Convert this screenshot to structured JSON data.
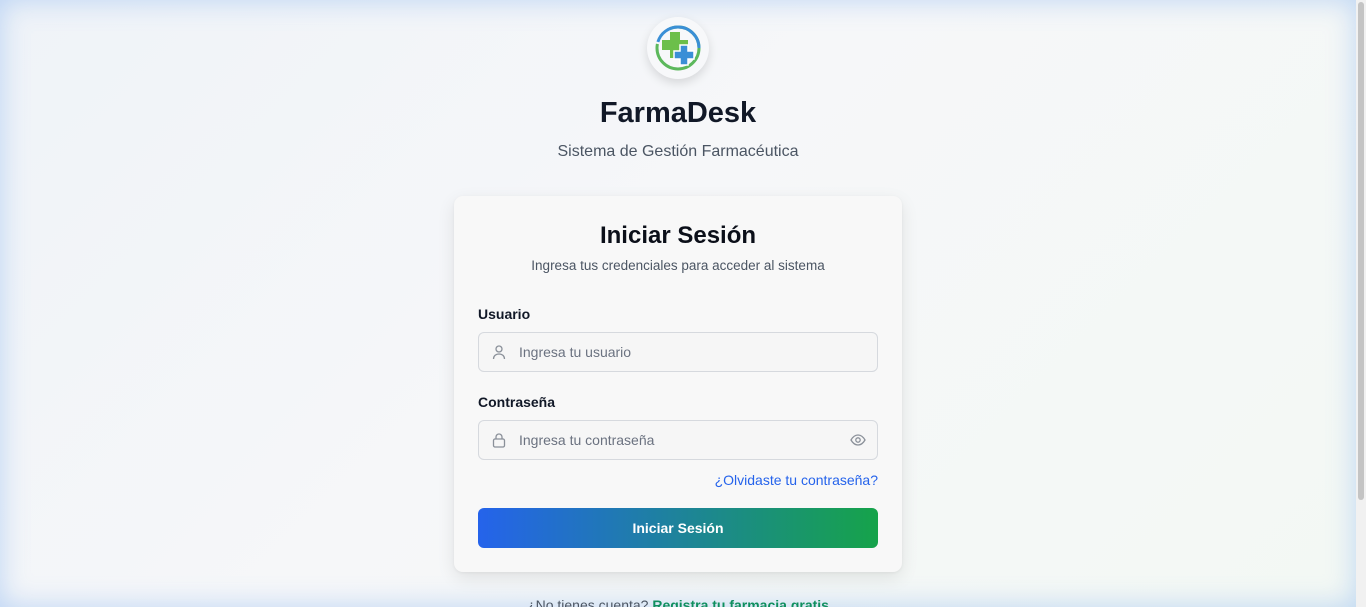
{
  "brand": {
    "logo_icon": "medical-cross-logo-icon",
    "title": "FarmaDesk",
    "subtitle": "Sistema de Gestión Farmacéutica"
  },
  "login": {
    "title": "Iniciar Sesión",
    "subtitle": "Ingresa tus credenciales para acceder al sistema",
    "username": {
      "label": "Usuario",
      "placeholder": "Ingresa tu usuario",
      "value": "",
      "icon": "user-icon"
    },
    "password": {
      "label": "Contraseña",
      "placeholder": "Ingresa tu contraseña",
      "value": "",
      "icon": "lock-icon",
      "toggle_icon": "eye-icon"
    },
    "forgot_label": "¿Olvidaste tu contraseña?",
    "submit_label": "Iniciar Sesión"
  },
  "footer": {
    "prompt": "¿No tienes cuenta?",
    "register_label": "Registra tu farmacia gratis"
  },
  "colors": {
    "accent_blue": "#2563eb",
    "accent_green": "#16a34a",
    "link": "#2563eb"
  }
}
